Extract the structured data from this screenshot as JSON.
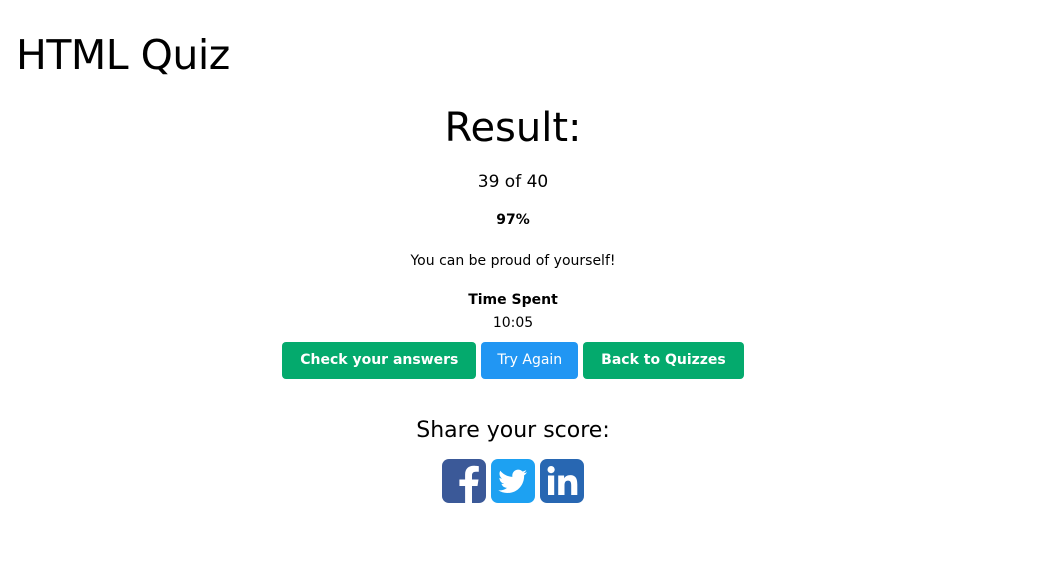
{
  "page": {
    "title": "HTML Quiz"
  },
  "result": {
    "heading": "Result:",
    "score": "39 of 40",
    "percent": "97%",
    "message": "You can be proud of yourself!",
    "time_label": "Time Spent",
    "time_value": "10:05"
  },
  "actions": {
    "check_label": "Check your answers",
    "retry_label": "Try Again",
    "back_label": "Back to Quizzes"
  },
  "share": {
    "heading": "Share your score:",
    "icons": [
      "facebook-icon",
      "twitter-icon",
      "linkedin-icon"
    ]
  },
  "colors": {
    "green": "#04aa6d",
    "blue": "#2196f3",
    "facebook": "#3b5998",
    "twitter": "#1da1f2",
    "linkedin": "#2867b2"
  }
}
